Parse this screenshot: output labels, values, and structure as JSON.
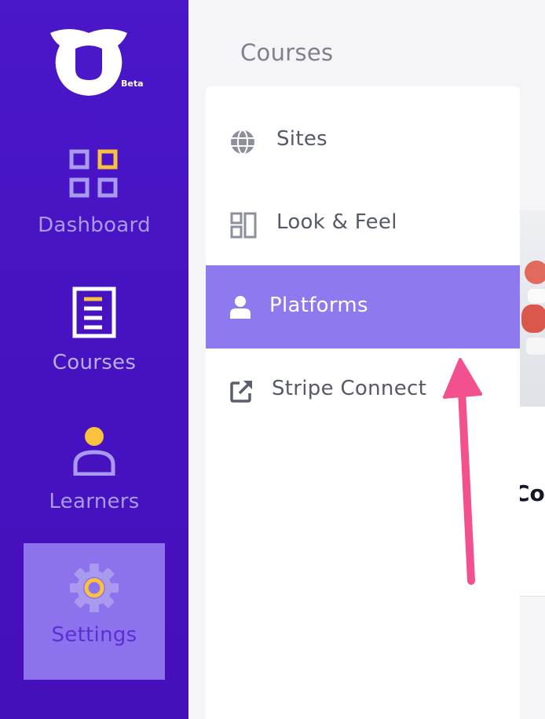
{
  "sidebar": {
    "logo_badge": "Beta",
    "items": [
      {
        "label": "Dashboard",
        "icon": "dashboard-grid-icon"
      },
      {
        "label": "Courses",
        "icon": "document-icon"
      },
      {
        "label": "Learners",
        "icon": "user-icon"
      },
      {
        "label": "Settings",
        "icon": "gear-icon",
        "active": true
      }
    ]
  },
  "main": {
    "heading": "Courses",
    "submenu": [
      {
        "label": "Sites",
        "icon": "globe-icon"
      },
      {
        "label": "Look & Feel",
        "icon": "layout-icon"
      },
      {
        "label": "Platforms",
        "icon": "user-icon",
        "active": true
      },
      {
        "label": "Stripe Connect",
        "icon": "external-link-icon"
      }
    ],
    "background_card_title": "Cou"
  },
  "colors": {
    "sidebar_bg": "#4a17c9",
    "active_bg": "#8e79ef",
    "accent_yellow": "#f9c23c",
    "icon_lavender": "#a99af0",
    "annotation_arrow": "#f2508f"
  }
}
